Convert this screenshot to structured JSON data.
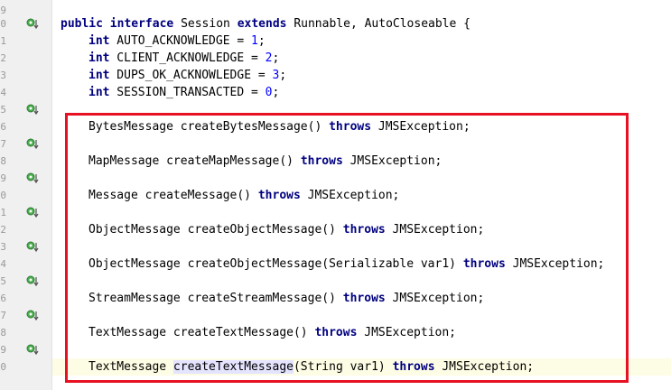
{
  "editor": {
    "line_numbers": [
      "9",
      "0",
      "1",
      "2",
      "3",
      "4",
      "5",
      "6",
      "7",
      "8",
      "9",
      "0",
      "1",
      "2",
      "3",
      "4",
      "5",
      "6",
      "7",
      "8",
      "9",
      "0"
    ],
    "marker_icon": "implemented-method-gutter-icon",
    "highlight_color": "#e81123"
  },
  "code": {
    "decl": {
      "kw1": "public",
      "kw2": "interface",
      "name": " Session ",
      "kw3": "extends",
      "rest": " Runnable, AutoCloseable {"
    },
    "constants": [
      {
        "type": "int",
        "name": " AUTO_ACKNOWLEDGE = ",
        "value": "1",
        "end": ";"
      },
      {
        "type": "int",
        "name": " CLIENT_ACKNOWLEDGE = ",
        "value": "2",
        "end": ";"
      },
      {
        "type": "int",
        "name": " DUPS_OK_ACKNOWLEDGE = ",
        "value": "3",
        "end": ";"
      },
      {
        "type": "int",
        "name": " SESSION_TRANSACTED = ",
        "value": "0",
        "end": ";"
      }
    ],
    "methods": [
      {
        "sig": "BytesMessage createBytesMessage() ",
        "throws": "throws",
        "exc": " JMSException;"
      },
      {
        "sig": "MapMessage createMapMessage() ",
        "throws": "throws",
        "exc": " JMSException;"
      },
      {
        "sig": "Message createMessage() ",
        "throws": "throws",
        "exc": " JMSException;"
      },
      {
        "sig": "ObjectMessage createObjectMessage() ",
        "throws": "throws",
        "exc": " JMSException;"
      },
      {
        "sig": "ObjectMessage createObjectMessage(Serializable var1) ",
        "throws": "throws",
        "exc": " JMSException;"
      },
      {
        "sig": "StreamMessage createStreamMessage() ",
        "throws": "throws",
        "exc": " JMSException;"
      },
      {
        "sig": "TextMessage createTextMessage() ",
        "throws": "throws",
        "exc": " JMSException;"
      }
    ],
    "last_method": {
      "pre": "TextMessage ",
      "method": "createTextMessage",
      "args": "(String var1) ",
      "throws": "throws",
      "exc": " JMSException;"
    }
  }
}
